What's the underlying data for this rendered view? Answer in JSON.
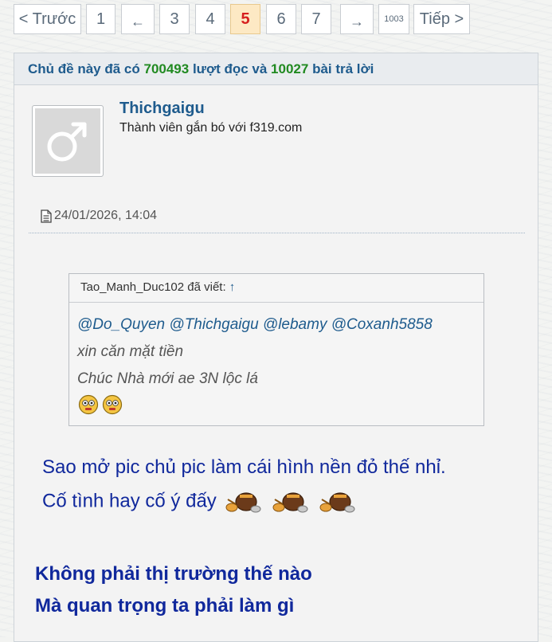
{
  "pagination": {
    "prev": "< Trước",
    "first": "1",
    "left_arrow": "←",
    "pages": [
      "3",
      "4",
      "5",
      "6",
      "7"
    ],
    "current": "5",
    "right_arrow": "→",
    "last": "1003",
    "next": "Tiếp >"
  },
  "stats": {
    "prefix": "Chủ đề này đã có",
    "views": "700493",
    "middle": "lượt đọc và",
    "replies": "10027",
    "suffix": "bài trả lời"
  },
  "post": {
    "username": "Thichgaigu",
    "user_title": "Thành viên gắn bó với f319.com",
    "date": "24/01/2026, 14:04",
    "quote": {
      "author_line": "Tao_Manh_Duc102 đã viết:",
      "up_arrow": "↑",
      "mentions": "@Do_Quyen @Thichgaigu @lebamy @Coxanh5858",
      "lines": [
        "xin căn mặt tiền",
        "Chúc Nhà mới ae 3N lộc lá"
      ]
    },
    "message_lines": [
      "Sao mở pic chủ pic làm cái hình nền đỏ thế nhỉ.",
      "Cố tình hay cố ý đấy"
    ],
    "signature_lines": [
      "Không phải thị trường thế nào",
      "Mà quan trọng ta phải làm gì"
    ]
  },
  "colors": {
    "link_blue": "#1e5b8d",
    "stat_green": "#218a21",
    "message_blue": "#10289c",
    "current_page": "#d61f1f"
  },
  "icons": [
    "male-symbol-icon",
    "document-icon",
    "smiley-icon",
    "bomb-emoticon-icon"
  ]
}
